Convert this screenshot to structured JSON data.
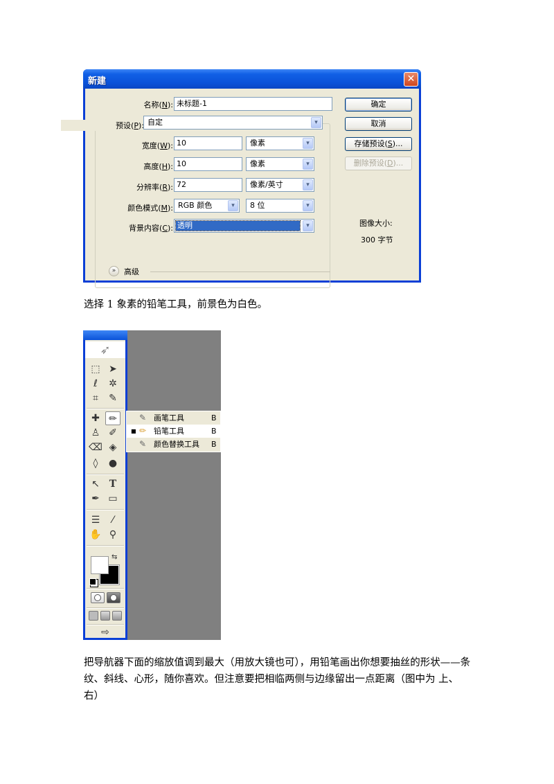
{
  "dialog": {
    "title": "新建",
    "close_icon": "close-icon",
    "fields": {
      "name": {
        "label_pre": "名称(",
        "label_key": "N",
        "label_post": "):",
        "value": "未标题-1"
      },
      "preset": {
        "label_pre": "预设(",
        "label_key": "P",
        "label_post": "):",
        "value": "自定"
      },
      "width": {
        "label_pre": "宽度(",
        "label_key": "W",
        "label_post": "):",
        "value": "10",
        "unit": "像素"
      },
      "height": {
        "label_pre": "高度(",
        "label_key": "H",
        "label_post": "):",
        "value": "10",
        "unit": "像素"
      },
      "resolution": {
        "label_pre": "分辨率(",
        "label_key": "R",
        "label_post": "):",
        "value": "72",
        "unit": "像素/英寸"
      },
      "color_mode": {
        "label_pre": "颜色模式(",
        "label_key": "M",
        "label_post": "):",
        "value": "RGB 颜色",
        "depth": "8 位"
      },
      "background": {
        "label_pre": "背景内容(",
        "label_key": "C",
        "label_post": "):",
        "value": "透明"
      }
    },
    "advanced_label": "高级",
    "buttons": {
      "ok": "确定",
      "cancel": "取消",
      "save_preset_pre": "存储预设(",
      "save_preset_key": "S",
      "save_preset_post": ")...",
      "delete_preset_pre": "删除预设(",
      "delete_preset_key": "D",
      "delete_preset_post": ")..."
    },
    "image_size_label": "图像大小:",
    "image_size_value": "300 字节",
    "dropdown_arrow": "⌄"
  },
  "paragraph1": "选择 1 象素的铅笔工具，前景色为白色。",
  "toolbox": {
    "tools": [
      {
        "name": "marquee-tool",
        "glyph": "⬚"
      },
      {
        "name": "move-tool",
        "glyph": "➤"
      },
      {
        "name": "lasso-tool",
        "glyph": "ℓ"
      },
      {
        "name": "magic-wand-tool",
        "glyph": "✲"
      },
      {
        "name": "crop-tool",
        "glyph": "⌗"
      },
      {
        "name": "slice-tool",
        "glyph": "✎"
      },
      {
        "name": "healing-brush-tool",
        "glyph": "✚"
      },
      {
        "name": "pencil-tool",
        "glyph": "✏"
      },
      {
        "name": "clone-stamp-tool",
        "glyph": "♙"
      },
      {
        "name": "history-brush-tool",
        "glyph": "✐"
      },
      {
        "name": "eraser-tool",
        "glyph": "⌫"
      },
      {
        "name": "paint-bucket-tool",
        "glyph": "◈"
      },
      {
        "name": "blur-tool",
        "glyph": "💧"
      },
      {
        "name": "dodge-tool",
        "glyph": "●"
      },
      {
        "name": "path-selection-tool",
        "glyph": "↖"
      },
      {
        "name": "type-tool",
        "glyph": "T"
      },
      {
        "name": "pen-tool",
        "glyph": "✒"
      },
      {
        "name": "rectangle-tool",
        "glyph": "▭"
      },
      {
        "name": "notes-tool",
        "glyph": "☰"
      },
      {
        "name": "eyedropper-tool",
        "glyph": "⁄"
      },
      {
        "name": "hand-tool",
        "glyph": "✋"
      },
      {
        "name": "zoom-tool",
        "glyph": "🔍"
      }
    ],
    "flyout": [
      {
        "label": "画笔工具",
        "shortcut": "B",
        "icon": "✎",
        "current": false
      },
      {
        "label": "铅笔工具",
        "shortcut": "B",
        "icon": "✏",
        "current": true,
        "bullet": "■"
      },
      {
        "label": "颜色替换工具",
        "shortcut": "B",
        "icon": "✎",
        "current": false
      }
    ],
    "swap_glyph": "⇆",
    "jump_glyph": "⇨"
  },
  "paragraph2": "把导航器下面的缩放值调到最大（用放大镜也可），用铅笔画出你想要抽丝的形状——条纹、斜线、心形，随你喜欢。但注意要把相临两侧与边缘留出一点距离（图中为 上、右）"
}
